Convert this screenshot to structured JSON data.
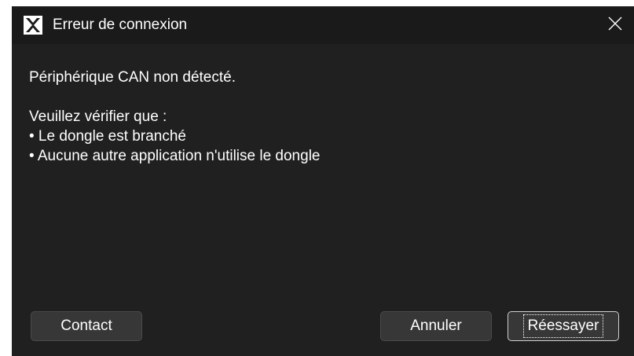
{
  "window": {
    "title": "Erreur de connexion",
    "app_icon": "x-logo-icon",
    "close_icon": "close-icon"
  },
  "message": {
    "headline": "Périphérique CAN non détecté.",
    "intro": "Veuillez vérifier que :",
    "bullets": [
      "• Le dongle est branché",
      "• Aucune autre application n'utilise le dongle"
    ]
  },
  "buttons": {
    "contact_label": "Contact",
    "cancel_label": "Annuler",
    "retry_label": "Réessayer"
  },
  "colors": {
    "background": "#202020",
    "titlebar": "#1a1a1a",
    "button": "#373737",
    "text": "#ffffff"
  }
}
